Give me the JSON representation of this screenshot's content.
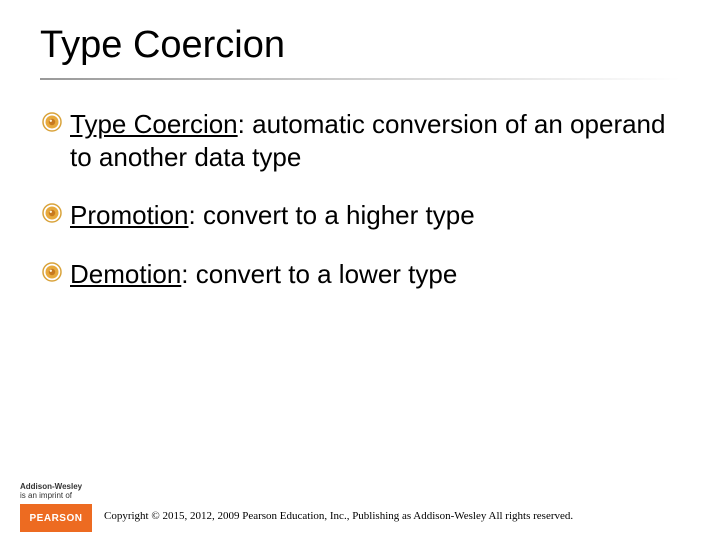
{
  "title": "Type Coercion",
  "bullets": [
    {
      "term": "Type Coercion",
      "rest": ": automatic conversion of an operand to another data type"
    },
    {
      "term": "Promotion",
      "rest": ": convert to a higher type"
    },
    {
      "term": "Demotion",
      "rest": ": convert to a lower type"
    }
  ],
  "footer": {
    "aw_name": "Addison-Wesley",
    "aw_sub": "is an imprint of",
    "pearson": "PEARSON",
    "copyright": "Copyright © 2015, 2012, 2009 Pearson Education, Inc., Publishing as Addison-Wesley All rights reserved."
  }
}
